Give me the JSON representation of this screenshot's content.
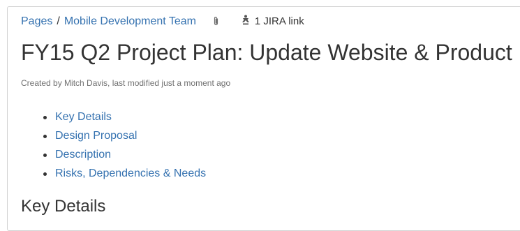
{
  "breadcrumb": {
    "pages_label": "Pages",
    "separator": "/",
    "space_label": "Mobile Development Team"
  },
  "attachments_icon": "paperclip-icon",
  "jira": {
    "icon": "jira-icon",
    "label": "1 JIRA link"
  },
  "page": {
    "title": "FY15 Q2 Project Plan: Update Website & Product",
    "byline": "Created by Mitch Davis, last modified just a moment ago"
  },
  "toc": {
    "items": [
      {
        "label": "Key Details"
      },
      {
        "label": "Design Proposal"
      },
      {
        "label": "Description"
      },
      {
        "label": "Risks, Dependencies & Needs"
      }
    ]
  },
  "section": {
    "heading": "Key Details"
  },
  "colors": {
    "link": "#3572b0",
    "text": "#333333",
    "meta": "#707070",
    "border": "#d2d2d2"
  }
}
